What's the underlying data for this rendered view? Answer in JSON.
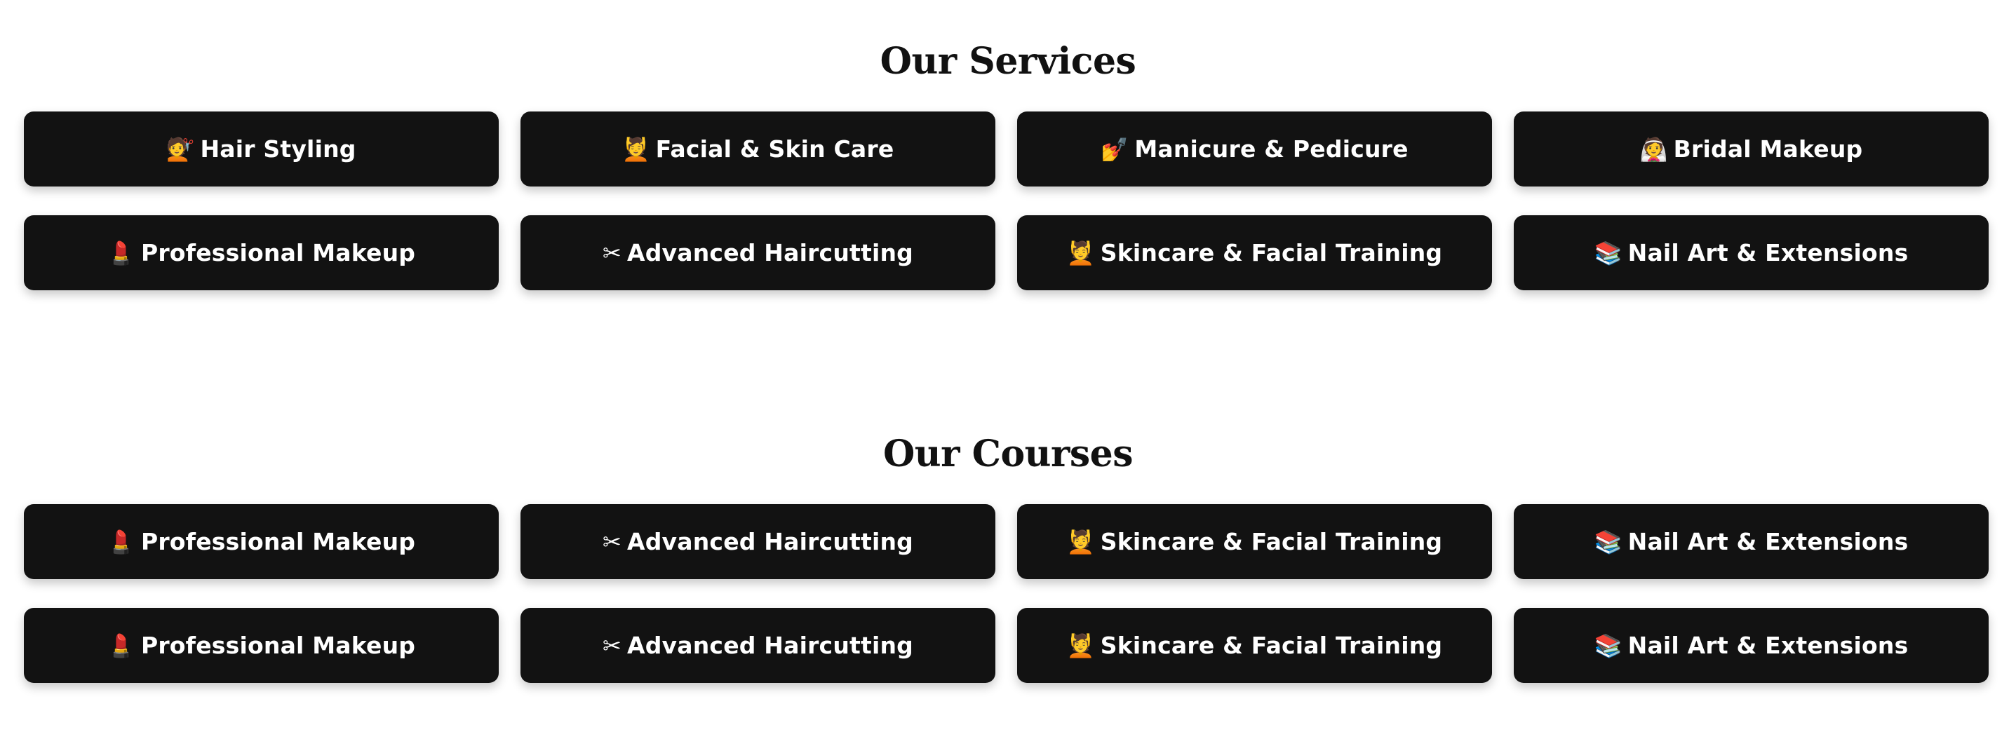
{
  "services": {
    "title": "Our Services",
    "items": [
      {
        "icon": "💇",
        "icon_name": "woman-getting-haircut-icon",
        "label": "Hair Styling"
      },
      {
        "icon": "💆",
        "icon_name": "face-massage-icon",
        "label": "Facial & Skin Care"
      },
      {
        "icon": "💅",
        "icon_name": "nail-polish-icon",
        "label": "Manicure & Pedicure"
      },
      {
        "icon": "👰",
        "icon_name": "bride-icon",
        "label": "Bridal Makeup"
      },
      {
        "icon": "💄",
        "icon_name": "lipstick-icon",
        "label": "Professional Makeup"
      },
      {
        "icon": "✂",
        "icon_name": "scissors-icon",
        "label": "Advanced Haircutting"
      },
      {
        "icon": "💆",
        "icon_name": "face-massage-icon",
        "label": "Skincare & Facial Training"
      },
      {
        "icon": "📚",
        "icon_name": "books-icon",
        "label": "Nail Art & Extensions"
      }
    ]
  },
  "courses": {
    "title": "Our Courses",
    "items": [
      {
        "icon": "💄",
        "icon_name": "lipstick-icon",
        "label": "Professional Makeup"
      },
      {
        "icon": "✂",
        "icon_name": "scissors-icon",
        "label": "Advanced Haircutting"
      },
      {
        "icon": "💆",
        "icon_name": "face-massage-icon",
        "label": "Skincare & Facial Training"
      },
      {
        "icon": "📚",
        "icon_name": "books-icon",
        "label": "Nail Art & Extensions"
      },
      {
        "icon": "💄",
        "icon_name": "lipstick-icon",
        "label": "Professional Makeup"
      },
      {
        "icon": "✂",
        "icon_name": "scissors-icon",
        "label": "Advanced Haircutting"
      },
      {
        "icon": "💆",
        "icon_name": "face-massage-icon",
        "label": "Skincare & Facial Training"
      },
      {
        "icon": "📚",
        "icon_name": "books-icon",
        "label": "Nail Art & Extensions"
      }
    ]
  },
  "colors": {
    "card_background": "#121212",
    "card_text": "#ffffff",
    "heading_text": "#111111",
    "page_background": "#ffffff"
  }
}
